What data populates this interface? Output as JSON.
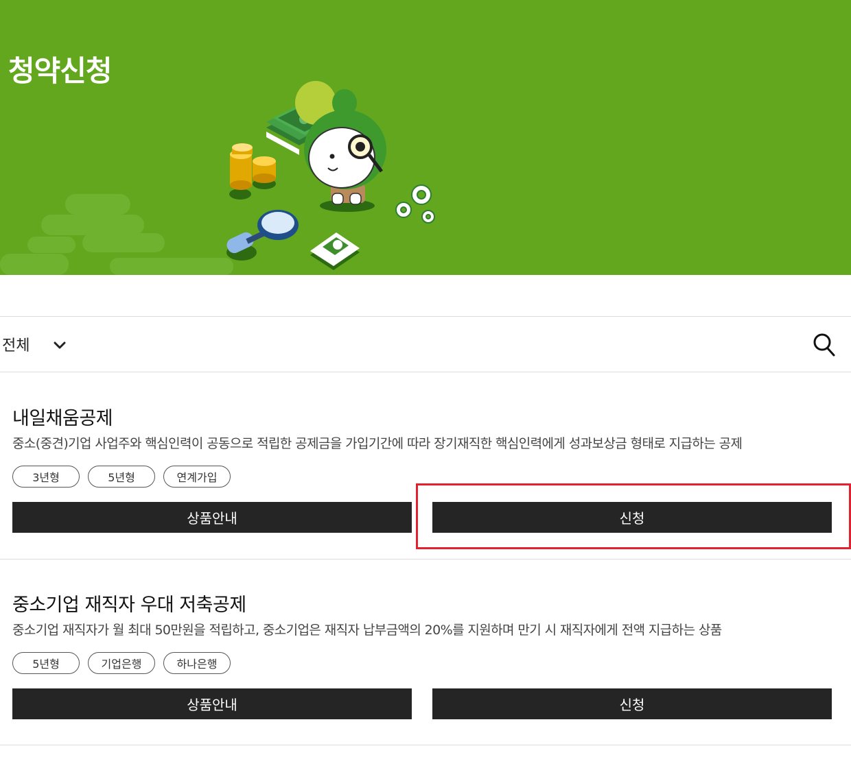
{
  "header": {
    "title": "청약신청",
    "illustration": "mascot-with-magnifier-icon"
  },
  "filter": {
    "selected": "전체",
    "dropdown_icon": "chevron-down-icon",
    "search_icon": "search-icon"
  },
  "products": [
    {
      "title": "내일채움공제",
      "description": "중소(중견)기업 사업주와 핵심인력이 공동으로 적립한 공제금을 가입기간에 따라 장기재직한 핵심인력에게 성과보상금 형태로 지급하는 공제",
      "tags": [
        "3년형",
        "5년형",
        "연계가입"
      ],
      "info_button": "상품안내",
      "apply_button": "신청"
    },
    {
      "title": "중소기업 재직자 우대 저축공제",
      "description": "중소기업 재직자가 월 최대 50만원을 적립하고, 중소기업은 재직자 납부금액의 20%를 지원하며 만기 시 재직자에게 전액 지급하는 상품",
      "tags": [
        "5년형",
        "기업은행",
        "하나은행"
      ],
      "info_button": "상품안내",
      "apply_button": "신청"
    }
  ],
  "colors": {
    "hero_background": "#63a71e",
    "button_background": "#252525",
    "highlight_border": "#e3202b"
  }
}
